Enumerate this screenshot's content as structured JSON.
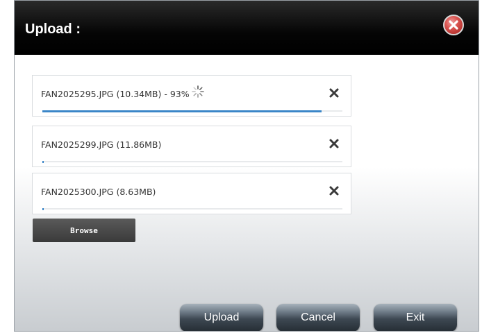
{
  "dialog": {
    "title": "Upload :"
  },
  "files": [
    {
      "name": "FAN2025295.JPG (10.34MB) - 93%",
      "progress": 0.93,
      "uploading": true
    },
    {
      "name": "FAN2025299.JPG (11.86MB)",
      "progress": 0.0,
      "uploading": false
    },
    {
      "name": "FAN2025300.JPG (8.63MB)",
      "progress": 0.0,
      "uploading": false
    }
  ],
  "buttons": {
    "browse": "Browse",
    "upload": "Upload",
    "cancel": "Cancel",
    "exit": "Exit"
  },
  "icons": {
    "close": "close-icon",
    "remove": "x-icon",
    "spinner": "spinner-icon"
  },
  "colors": {
    "title_bar": "#000000",
    "close_red": "#d9534f",
    "progress_fill": "#3b86c8"
  }
}
